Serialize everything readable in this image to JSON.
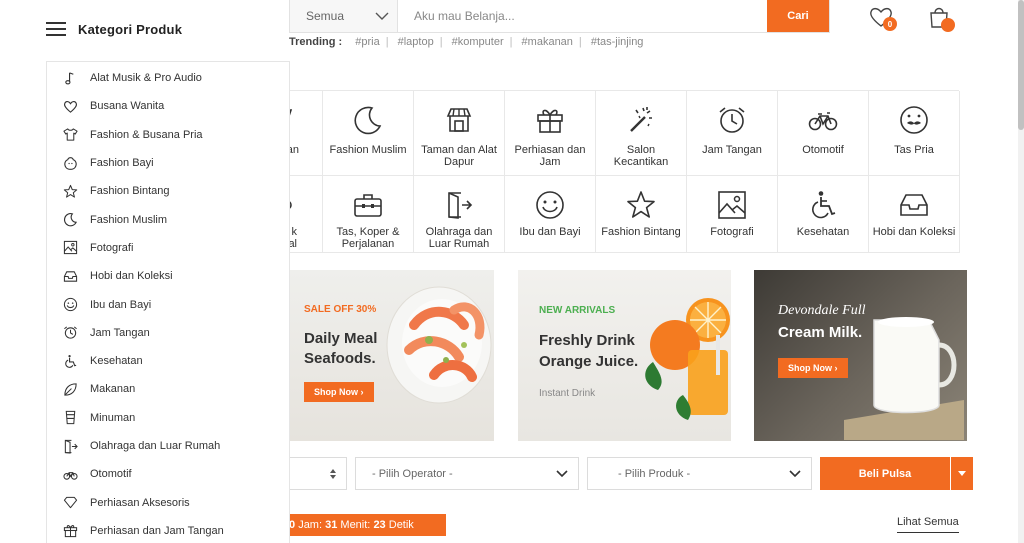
{
  "header": {
    "category_label": "Kategori Produk",
    "search": {
      "category_select": "Semua",
      "placeholder": "Aku mau Belanja...",
      "button": "Cari"
    },
    "trending": {
      "label": "Trending :",
      "tags": [
        "#pria",
        "#laptop",
        "#komputer",
        "#makanan",
        "#tas-jinjing"
      ]
    },
    "wishlist_count": "0",
    "accent_color": "#f26b21"
  },
  "sidebar": {
    "items": [
      {
        "label": "Alat Musik & Pro Audio",
        "icon": "music-note-icon"
      },
      {
        "label": "Busana Wanita",
        "icon": "heart-icon"
      },
      {
        "label": "Fashion & Busana Pria",
        "icon": "tshirt-icon"
      },
      {
        "label": "Fashion Bayi",
        "icon": "baby-icon"
      },
      {
        "label": "Fashion Bintang",
        "icon": "star-icon"
      },
      {
        "label": "Fashion Muslim",
        "icon": "moon-icon"
      },
      {
        "label": "Fotografi",
        "icon": "image-icon"
      },
      {
        "label": "Hobi dan Koleksi",
        "icon": "inbox-icon"
      },
      {
        "label": "Ibu dan Bayi",
        "icon": "smile-icon"
      },
      {
        "label": "Jam Tangan",
        "icon": "alarm-clock-icon"
      },
      {
        "label": "Kesehatan",
        "icon": "wheelchair-icon"
      },
      {
        "label": "Makanan",
        "icon": "leaf-icon"
      },
      {
        "label": "Minuman",
        "icon": "cup-icon"
      },
      {
        "label": "Olahraga dan Luar Rumah",
        "icon": "exit-door-icon"
      },
      {
        "label": "Otomotif",
        "icon": "bicycle-icon"
      },
      {
        "label": "Perhiasan Aksesoris",
        "icon": "diamond-icon"
      },
      {
        "label": "Perhiasan dan Jam Tangan",
        "icon": "gift-icon"
      }
    ]
  },
  "grid": {
    "row1": [
      {
        "label": "...an",
        "icon": "partial-icon"
      },
      {
        "label": "Fashion Muslim",
        "icon": "moon-icon"
      },
      {
        "label": "Taman dan Alat Dapur",
        "icon": "store-icon"
      },
      {
        "label": "Perhiasan dan Jam",
        "icon": "gift-icon"
      },
      {
        "label": "Salon Kecantikan",
        "icon": "magic-wand-icon"
      },
      {
        "label": "Jam Tangan",
        "icon": "alarm-clock-icon"
      },
      {
        "label": "Otomotif",
        "icon": "bicycle-icon"
      },
      {
        "label": "Tas Pria",
        "icon": "mustache-face-icon"
      }
    ],
    "row2": [
      {
        "label": "k\nal",
        "icon": "partial-icon"
      },
      {
        "label": "Tas, Koper & Perjalanan",
        "icon": "briefcase-icon"
      },
      {
        "label": "Olahraga dan Luar Rumah",
        "icon": "exit-door-icon"
      },
      {
        "label": "Ibu dan Bayi",
        "icon": "smile-icon"
      },
      {
        "label": "Fashion Bintang",
        "icon": "star-icon"
      },
      {
        "label": "Fotografi",
        "icon": "image-icon"
      },
      {
        "label": "Kesehatan",
        "icon": "wheelchair-icon"
      },
      {
        "label": "Hobi dan Koleksi",
        "icon": "inbox-icon"
      }
    ]
  },
  "banners": [
    {
      "tag": "SALE OFF 30%",
      "title1": "Daily Meal",
      "title2": "Seafoods.",
      "button": "Shop Now ›"
    },
    {
      "tag": "NEW ARRIVALS",
      "title1": "Freshly Drink",
      "title2": "Orange Juice.",
      "sub": "Instant Drink"
    },
    {
      "title1": "Devondale Full",
      "title2": "Cream Milk.",
      "button": "Shop Now ›"
    }
  ],
  "pulsa": {
    "operator": "- Pilih Operator -",
    "product": "- Pilih Produk -",
    "button": "Beli Pulsa"
  },
  "flash": {
    "hours": "0",
    "hours_label": "Jam:",
    "minutes": "31",
    "minutes_label": "Menit:",
    "seconds": "23",
    "seconds_label": "Detik"
  },
  "see_all": "Lihat Semua"
}
